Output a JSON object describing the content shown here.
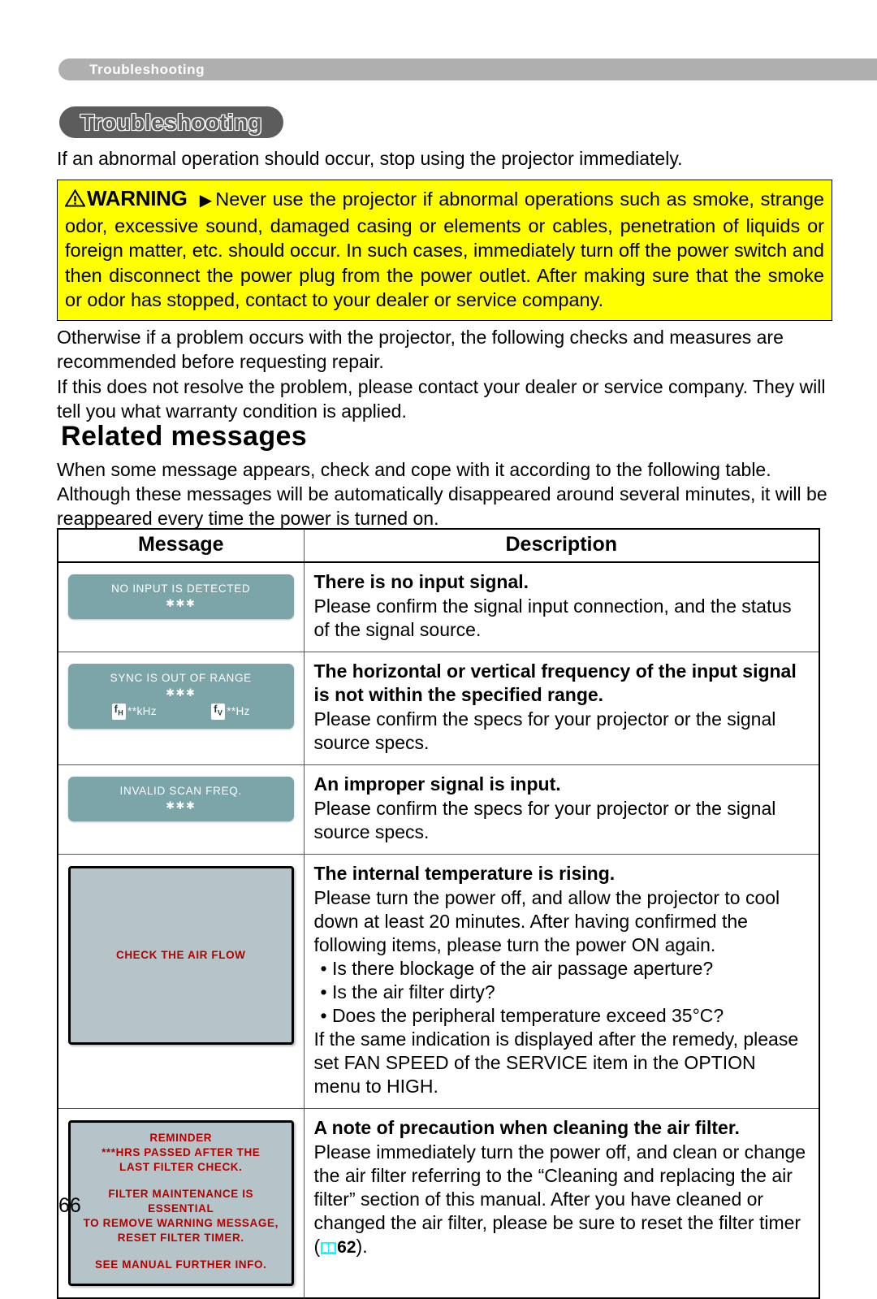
{
  "running_header": {
    "label": "Troubleshooting"
  },
  "chapter": {
    "title": "Troubleshooting"
  },
  "lead_line": "If an abnormal operation should occur, stop using the projector immediately.",
  "warning": {
    "word": "WARNING",
    "arrow": "▶",
    "text": "Never use the projector if abnormal operations such as smoke, strange odor, excessive sound, damaged casing or elements or cables, penetration of liquids or foreign matter, etc. should occur. In such cases, immediately turn off the power switch and then disconnect the power plug from the power outlet. After making sure that the smoke or odor has stopped, contact to your dealer or service company.",
    "background_color": "#FFFF00"
  },
  "after_warning": {
    "para1": "Otherwise if a problem occurs with the projector, the following checks and measures are recommended before requesting repair.",
    "para2": "If this does not resolve the problem, please contact your dealer or service company. They will tell you what warranty condition is applied."
  },
  "section": {
    "heading": "Related messages",
    "intro": "When some message appears, check and cope with it according to the following table. Although these messages will be automatically disappeared around several minutes, it will be reappeared every time the power is turned on."
  },
  "table": {
    "headers": {
      "message": "Message",
      "description": "Description"
    },
    "rows": [
      {
        "osd": {
          "style": "teal",
          "line1": "NO INPUT IS DETECTED",
          "stars": "✱✱✱"
        },
        "desc_title": "There is no input signal.",
        "desc_body": "Please confirm the signal input connection, and the status of the signal source."
      },
      {
        "osd": {
          "style": "teal",
          "line1": "SYNC IS OUT OF RANGE",
          "stars": "✱✱✱",
          "freq_h_label": "f",
          "freq_h_sub": "H",
          "freq_h_value": "**kHz",
          "freq_v_label": "f",
          "freq_v_sub": "V",
          "freq_v_value": "**Hz"
        },
        "desc_title": "The horizontal or vertical frequency of the input signal is not within the specified range.",
        "desc_body": "Please confirm the specs for your projector or the signal source specs."
      },
      {
        "osd": {
          "style": "teal",
          "line1": "INVALID SCAN FREQ.",
          "stars": "✱✱✱"
        },
        "desc_title": "An improper signal is input.",
        "desc_body": "Please confirm the specs for your projector or the signal source specs."
      },
      {
        "osd": {
          "style": "screen",
          "line1": "CHECK THE AIR FLOW"
        },
        "desc_title": "The internal temperature is rising.",
        "desc_body_p1": "Please turn the power off, and allow the projector to cool down at least 20 minutes. After having confirmed the following items, please turn the power ON again.",
        "desc_bullets": [
          "• Is there blockage of the air passage aperture?",
          "• Is the air filter dirty?",
          "• Does the peripheral temperature exceed 35°C?"
        ],
        "desc_body_p2": "If the same indication is displayed after the remedy, please set FAN SPEED of the SERVICE item in the OPTION menu to HIGH."
      },
      {
        "osd": {
          "style": "screen",
          "reminder_title": "REMINDER",
          "reminder_l1": "***HRS PASSED AFTER THE",
          "reminder_l2": "LAST FILTER CHECK.",
          "reminder_l3": "FILTER MAINTENANCE IS ESSENTIAL",
          "reminder_l4": "TO REMOVE WARNING MESSAGE,",
          "reminder_l5": "RESET FILTER TIMER.",
          "reminder_l6": "SEE MANUAL FURTHER INFO."
        },
        "desc_title": "A note of precaution when cleaning the air filter.",
        "desc_body_pre": "Please immediately turn the power off, and clean or change the air filter referring to the “Cleaning and replacing the air filter” section of this manual. After you have cleaned or changed the air filter, please be sure to reset the filter timer (",
        "page_ref": "62",
        "desc_body_post": ").",
        "book_icon_color": "#00FFFF"
      }
    ]
  },
  "page_number": "66",
  "colors": {
    "header_gray": "#AFAFAF",
    "chapter_gray": "#5C5C5C",
    "osd_teal": "#7BA5A8",
    "osd_screen_bg": "#B5C4C8",
    "osd_screen_text": "#B50000",
    "warning_yellow": "#FFFF00"
  }
}
